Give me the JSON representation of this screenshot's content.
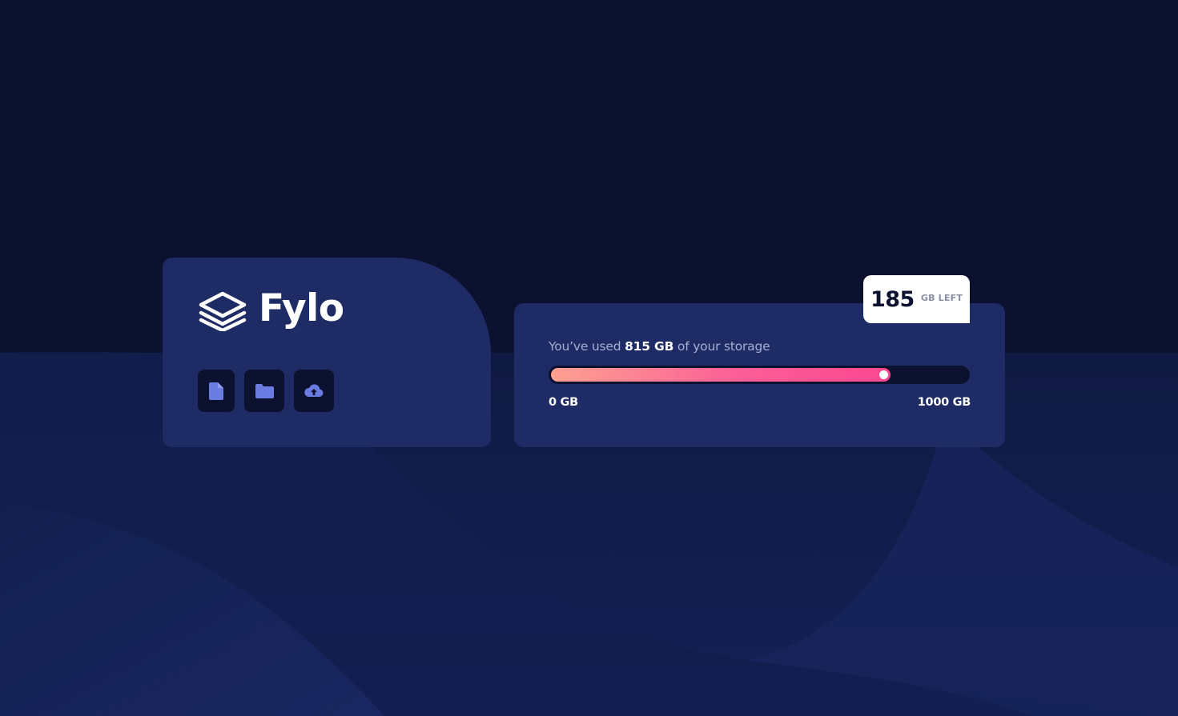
{
  "brand": {
    "name": "Fylo",
    "logo_icon": "stacked-layers-icon"
  },
  "actions": [
    {
      "icon": "document-icon"
    },
    {
      "icon": "folder-icon"
    },
    {
      "icon": "cloud-upload-icon"
    }
  ],
  "storage": {
    "text_prefix": "You’ve used",
    "used_label": "815 GB",
    "text_suffix": "of your storage",
    "min_label": "0 GB",
    "max_label": "1000 GB",
    "used_fraction": 0.815,
    "remaining_value": "185",
    "remaining_label": "GB LEFT"
  },
  "colors": {
    "page_background": "#0c1130",
    "card_background": "#1f2b64",
    "icon_color": "#6b7ce0",
    "progress_start": "#fda191",
    "progress_end": "#fb4890",
    "muted_text": "#a6aed4"
  }
}
